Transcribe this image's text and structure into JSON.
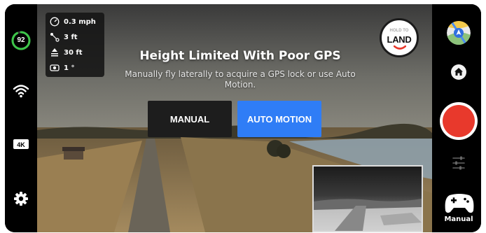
{
  "status": {
    "battery_percent": "92",
    "battery_fraction": 0.92,
    "resolution_badge": "4K"
  },
  "telemetry": {
    "speed": "0.3 mph",
    "distance": "3 ft",
    "altitude": "30 ft",
    "gimbal_angle": "1 °"
  },
  "land_button": {
    "top_text": "HOLD TO",
    "label": "LAND"
  },
  "alert": {
    "title": "Height Limited With Poor GPS",
    "description": "Manually fly laterally to acquire a GPS lock or use Auto Motion.",
    "manual_label": "MANUAL",
    "auto_motion_label": "AUTO MOTION"
  },
  "controls": {
    "mode_label": "Manual"
  },
  "colors": {
    "accent_blue": "#2f7df6",
    "record_red": "#e8392c",
    "battery_green": "#3ec64a"
  }
}
